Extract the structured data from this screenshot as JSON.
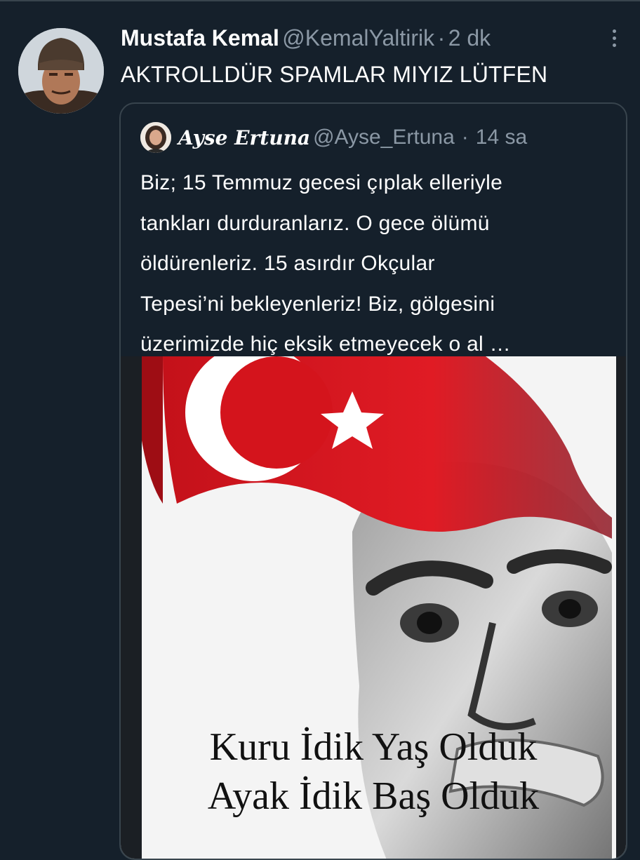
{
  "tweet": {
    "author_name": "Mustafa Kemal",
    "author_handle": "@KemalYaltirik",
    "separator": "·",
    "time": "2 dk",
    "text": "AKTROLLDÜR SPAMLAR MIYIZ LÜTFEN",
    "more_icon": "more-horizontal-icon"
  },
  "quote": {
    "author_name": "Ayse Ertuna",
    "author_handle": "@Ayse_Ertuna",
    "separator": "·",
    "time": "14 sa",
    "text_lines": [
      "Biz; 15 Temmuz gecesi çıplak elleriyle",
      "tankları durduranlarız. O gece ölümü",
      "öldürenleriz. 15 asırdır Okçular",
      "Tepesi’ni bekleyenleriz! Biz, gölgesini",
      "üzerimizde hiç eksik etmeyecek o al …"
    ],
    "media": {
      "caption_line_1": "Kuru İdik Yaş Olduk",
      "caption_line_2": "Ayak İdik Baş Olduk",
      "flag_color": "#d4141c"
    }
  },
  "colors": {
    "background": "#15202b",
    "border": "#38444d",
    "secondary_text": "#8b98a5"
  }
}
